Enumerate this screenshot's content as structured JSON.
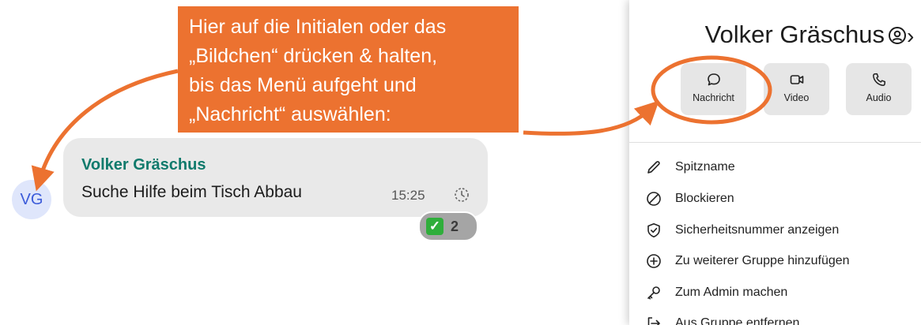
{
  "chat": {
    "avatar_initials": "VG",
    "message": {
      "sender": "Volker Gräschus",
      "text": "Suche Hilfe beim Tisch Abbau",
      "time": "15:25",
      "status_icon": "pending-clock-icon"
    },
    "reaction": {
      "emoji_icon": "check-mark-box-icon",
      "count": "2"
    }
  },
  "annotation": {
    "lines": [
      "Hier auf die Initialen oder das",
      "„Bildchen“ drücken & halten,",
      "bis das  Menü aufgeht und",
      "„Nachricht“ auswählen:"
    ],
    "color": "#ec7230"
  },
  "panel": {
    "title": "Volker Gräschus",
    "actions": [
      {
        "label": "Nachricht",
        "icon": "message-bubble-icon"
      },
      {
        "label": "Video",
        "icon": "video-camera-icon"
      },
      {
        "label": "Audio",
        "icon": "phone-icon"
      }
    ],
    "menu": [
      {
        "label": "Spitzname",
        "icon": "pencil-icon"
      },
      {
        "label": "Blockieren",
        "icon": "block-icon"
      },
      {
        "label": "Sicherheitsnummer anzeigen",
        "icon": "shield-check-icon"
      },
      {
        "label": "Zu weiterer Gruppe hinzufügen",
        "icon": "plus-circle-icon"
      },
      {
        "label": "Zum Admin machen",
        "icon": "key-icon"
      },
      {
        "label": "Aus Gruppe entfernen",
        "icon": "leave-group-icon"
      }
    ]
  },
  "colors": {
    "accent_orange": "#ec7230",
    "sender_teal": "#107a6c",
    "avatar_blue": "#3b5bd9",
    "bubble_gray": "#e9e9e9",
    "reaction_green": "#2fae3b"
  }
}
